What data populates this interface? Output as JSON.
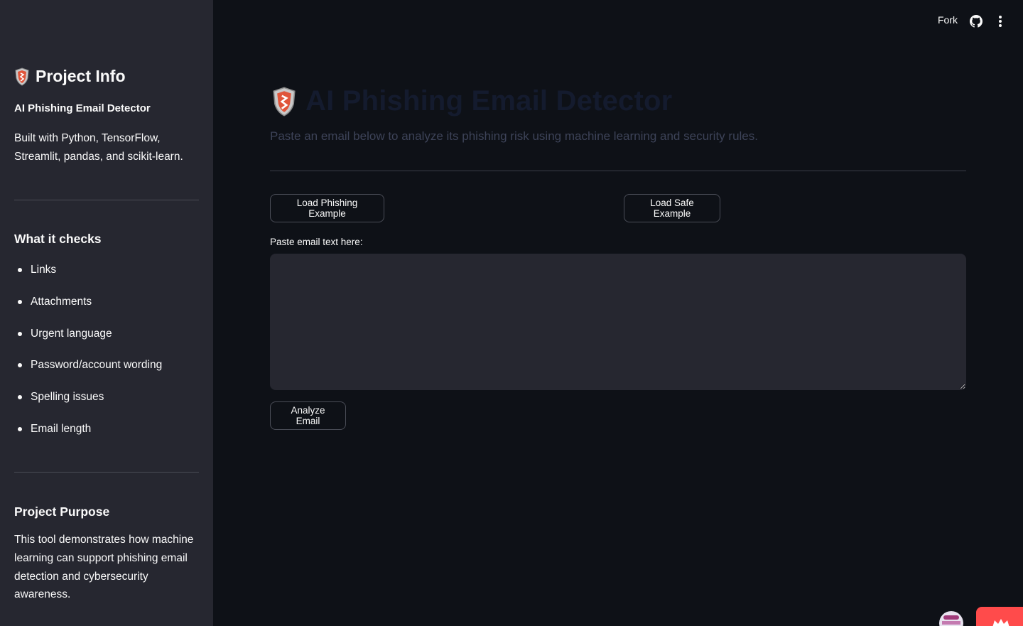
{
  "sidebar": {
    "title": "Project Info",
    "subtitle": "AI Phishing Email Detector",
    "built_with": "Built with Python, TensorFlow, Streamlit, pandas, and scikit-learn.",
    "checks_heading": "What it checks",
    "checks": [
      "Links",
      "Attachments",
      "Urgent language",
      "Password/account wording",
      "Spelling issues",
      "Email length"
    ],
    "purpose_heading": "Project Purpose",
    "purpose_text": "This tool demonstrates how machine learning can support phishing email detection and cybersecurity awareness."
  },
  "header": {
    "fork_label": "Fork",
    "icons": [
      "github-icon",
      "more-vertical-icon"
    ]
  },
  "main": {
    "title": "AI Phishing Email Detector",
    "subtitle": "Paste an email below to analyze its phishing risk using machine learning and security rules.",
    "load_phishing_label": "Load Phishing Example",
    "load_safe_label": "Load Safe Example",
    "textarea_label": "Paste email text here:",
    "textarea_value": "",
    "analyze_label": "Analyze Email"
  },
  "colors": {
    "background": "#0e1117",
    "sidebar": "#262730",
    "text": "#fafafa",
    "accent": "#ff4b4b"
  }
}
